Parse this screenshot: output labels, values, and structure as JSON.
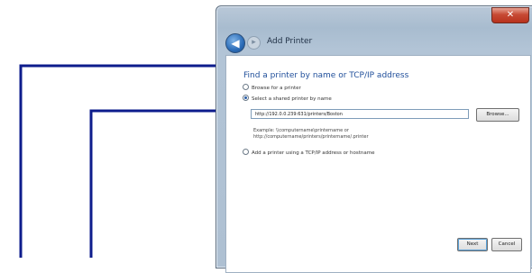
{
  "window": {
    "title": "Add Printer",
    "close_glyph": "✕",
    "back_glyph": "◀",
    "forward_glyph": "▸"
  },
  "dialog": {
    "heading": "Find a printer by name or TCP/IP address",
    "options": [
      {
        "label": "Browse for a printer",
        "selected": false
      },
      {
        "label": "Select a shared printer by name",
        "selected": true
      },
      {
        "label": "Add a printer using a TCP/IP address or hostname",
        "selected": false
      }
    ],
    "path_value": "http://192.0.0.239:631/printers/Boston",
    "browse_label": "Browse...",
    "example_line1": "Example: \\\\computername\\printername or",
    "example_line2": "http://computername/printers/printername/.printer"
  },
  "footer": {
    "next_label": "Next",
    "cancel_label": "Cancel"
  },
  "colors": {
    "callout": "#0d1c8c",
    "heading": "#1f4e9a"
  }
}
